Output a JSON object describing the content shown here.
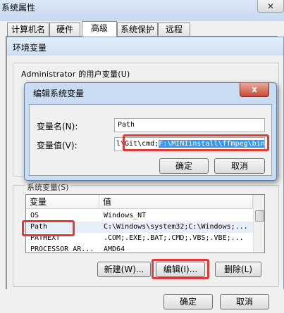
{
  "window": {
    "title": "系统属性",
    "close_glyph": "✕"
  },
  "tabs": [
    "计算机名",
    "硬件",
    "高级",
    "系统保护",
    "远程"
  ],
  "env_dialog": {
    "title": "环境变量",
    "user_group_label": "Administrator 的用户变量(U)",
    "system_group_label": "系统变量(S)",
    "table": {
      "headers": [
        "变量",
        "值"
      ],
      "rows": [
        {
          "name": "OS",
          "value": "Windows_NT"
        },
        {
          "name": "Path",
          "value": "C:\\Windows\\system32;C:\\Windows;..."
        },
        {
          "name": "PATHEXT",
          "value": ".COM;.EXE;.BAT;.CMD;.VBS;.VBE;..."
        },
        {
          "name": "PROCESSOR_AR...",
          "value": "AMD64"
        }
      ]
    },
    "buttons": {
      "new": "新建(W)...",
      "edit": "编辑(I)...",
      "delete": "删除(L)"
    },
    "ok": "确定",
    "cancel": "取消"
  },
  "edit_dialog": {
    "title": "编辑系统变量",
    "name_label": "变量名(N):",
    "name_value": "Path",
    "value_label": "变量值(V):",
    "value_plain": "l\\Git\\cmd;",
    "value_highlight": "F:\\MINIinstall\\ffmpeg\\bin",
    "ok": "确定",
    "cancel": "取消",
    "close_glyph": "x"
  },
  "colors": {
    "highlight": "#e53935",
    "selection": "#3399ff"
  }
}
